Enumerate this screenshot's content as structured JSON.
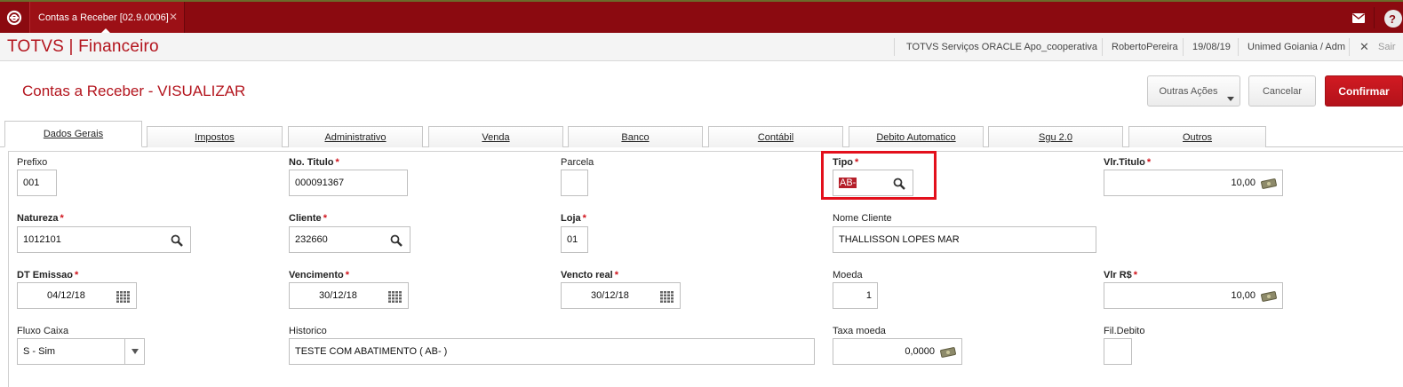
{
  "window": {
    "tab_label": "Contas a Receber [02.9.0006]",
    "tab_close": "✕",
    "help_label": "?"
  },
  "appbar": {
    "title": "TOTVS | Financeiro",
    "environment": "TOTVS Serviços ORACLE Apo_cooperativa",
    "user": "RobertoPereira",
    "date": "19/08/19",
    "branch": "Unimed Goiania / Adm",
    "exit_icon": "✕",
    "exit_label": "Sair"
  },
  "header": {
    "title": "Contas a Receber - VISUALIZAR",
    "other_actions_label": "Outras Ações",
    "cancel_label": "Cancelar",
    "confirm_label": "Confirmar"
  },
  "tabs": [
    {
      "label": "Dados Gerais",
      "active": true
    },
    {
      "label": "Impostos"
    },
    {
      "label": "Administrativo"
    },
    {
      "label": "Venda"
    },
    {
      "label": "Banco"
    },
    {
      "label": "Contábil"
    },
    {
      "label": "Debito Automatico"
    },
    {
      "label": "Sgu 2.0"
    },
    {
      "label": "Outros"
    }
  ],
  "form": {
    "prefixo": {
      "label": "Prefixo",
      "value": "001"
    },
    "no_titulo": {
      "label": "No. Titulo",
      "value": "000091367"
    },
    "parcela": {
      "label": "Parcela",
      "value": ""
    },
    "tipo": {
      "label": "Tipo",
      "value": "AB-"
    },
    "vlr_titulo": {
      "label": "Vlr.Titulo",
      "value": "10,00"
    },
    "natureza": {
      "label": "Natureza",
      "value": "1012101"
    },
    "cliente": {
      "label": "Cliente",
      "value": "232660"
    },
    "loja": {
      "label": "Loja",
      "value": "01"
    },
    "nome_cliente": {
      "label": "Nome Cliente",
      "value": "THALLISSON LOPES MAR"
    },
    "dt_emissao": {
      "label": "DT Emissao",
      "value": "04/12/18"
    },
    "vencimento": {
      "label": "Vencimento",
      "value": "30/12/18"
    },
    "vencto_real": {
      "label": "Vencto real",
      "value": "30/12/18"
    },
    "moeda": {
      "label": "Moeda",
      "value": "1"
    },
    "vlr_rs": {
      "label": "Vlr R$",
      "value": "10,00"
    },
    "fluxo_caixa": {
      "label": "Fluxo Caixa",
      "value": "S - Sim"
    },
    "historico": {
      "label": "Historico",
      "value": "TESTE COM ABATIMENTO ( AB- )"
    },
    "taxa_moeda": {
      "label": "Taxa moeda",
      "value": "0,0000"
    },
    "fil_debito": {
      "label": "Fil.Debito",
      "value": ""
    }
  },
  "required_mark": "*",
  "colors": {
    "topbar": "#8b0a10",
    "brand_red": "#b3141d",
    "highlight": "#e3101c"
  }
}
